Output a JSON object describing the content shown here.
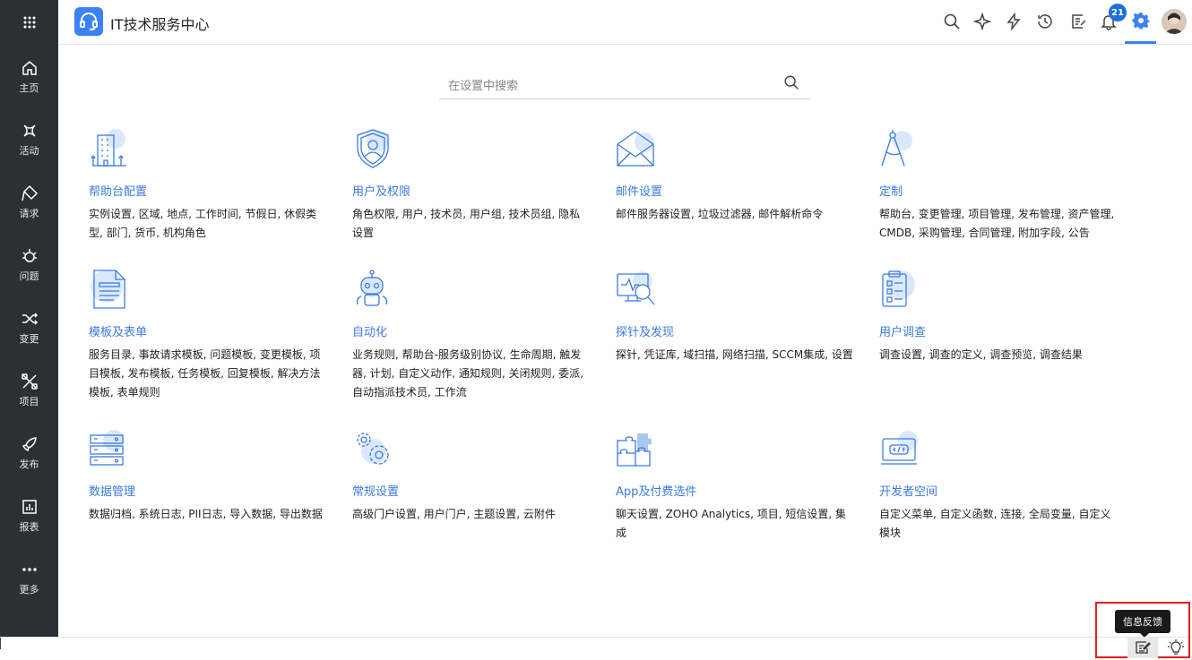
{
  "header": {
    "title": "IT技术服务中心",
    "notification_count": "21"
  },
  "sidebar": {
    "items": [
      {
        "label": "主页",
        "icon": "home-icon"
      },
      {
        "label": "活动",
        "icon": "activity-icon"
      },
      {
        "label": "请求",
        "icon": "request-icon"
      },
      {
        "label": "问题",
        "icon": "problem-icon"
      },
      {
        "label": "变更",
        "icon": "change-icon"
      },
      {
        "label": "项目",
        "icon": "project-icon"
      },
      {
        "label": "发布",
        "icon": "release-icon"
      },
      {
        "label": "报表",
        "icon": "report-icon"
      },
      {
        "label": "更多",
        "icon": "more-icon"
      }
    ]
  },
  "search": {
    "placeholder": "在设置中搜索"
  },
  "cards": [
    {
      "title": "帮助台配置",
      "desc": "实例设置, 区域, 地点, 工作时间, 节假日, 休假类型, 部门, 货币, 机构角色",
      "icon": "building-icon"
    },
    {
      "title": "用户及权限",
      "desc": "角色权限, 用户, 技术员, 用户组, 技术员组, 隐私设置",
      "icon": "user-shield-icon"
    },
    {
      "title": "邮件设置",
      "desc": "邮件服务器设置, 垃圾过滤器, 邮件解析命令",
      "icon": "envelope-icon"
    },
    {
      "title": "定制",
      "desc": "帮助台, 变更管理, 项目管理, 发布管理, 资产管理, CMDB, 采购管理, 合同管理, 附加字段, 公告",
      "icon": "compass-icon"
    },
    {
      "title": "模板及表单",
      "desc": "服务目录, 事故请求模板, 问题模板, 变更模板, 项目模板, 发布模板, 任务模板, 回复模板, 解决方法模板, 表单规则",
      "icon": "document-form-icon"
    },
    {
      "title": "自动化",
      "desc": "业务规则, 帮助台-服务级别协议, 生命周期, 触发器, 计划, 自定义动作, 通知规则, 关闭规则, 委派, 自动指派技术员, 工作流",
      "icon": "robot-icon"
    },
    {
      "title": "探针及发现",
      "desc": "探针, 凭证库, 域扫描, 网络扫描, SCCM集成, 设置",
      "icon": "monitor-scan-icon"
    },
    {
      "title": "用户调查",
      "desc": "调查设置, 调查的定义, 调查预览, 调查结果",
      "icon": "clipboard-survey-icon"
    },
    {
      "title": "数据管理",
      "desc": "数据归档, 系统日志, PII日志, 导入数据, 导出数据",
      "icon": "server-rack-icon"
    },
    {
      "title": "常规设置",
      "desc": "高级门户设置, 用户门户, 主题设置, 云附件",
      "icon": "gears-icon"
    },
    {
      "title": "App及付费选件",
      "desc": "聊天设置, ZOHO Analytics, 项目, 短信设置, 集成",
      "icon": "puzzle-icon"
    },
    {
      "title": "开发者空间",
      "desc": "自定义菜单, 自定义函数, 连接, 全局变量, 自定义模块",
      "icon": "code-laptop-icon"
    }
  ],
  "tooltip": "信息反馈",
  "colors": {
    "accent": "#3b82f6",
    "sidebar": "#2b2f36",
    "link": "#3b7be0",
    "highlight_box": "#e02020"
  }
}
